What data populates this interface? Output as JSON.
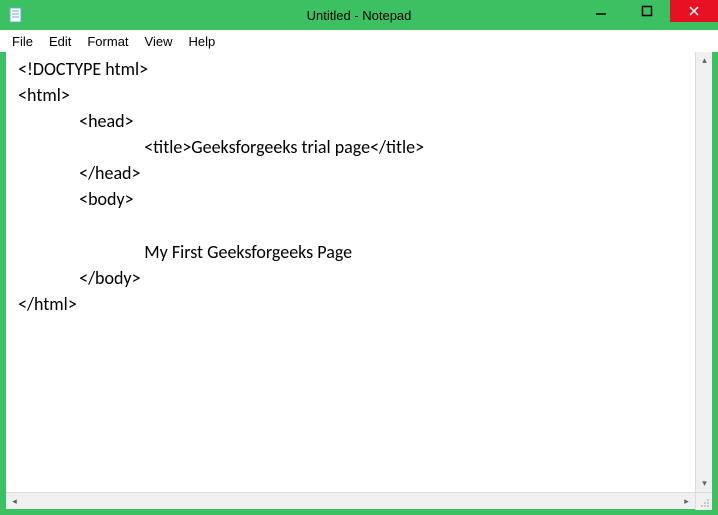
{
  "window": {
    "title": "Untitled - Notepad"
  },
  "menu": {
    "file": "File",
    "edit": "Edit",
    "format": "Format",
    "view": "View",
    "help": "Help"
  },
  "editor": {
    "content": " <!DOCTYPE html>\n <html>\n                <head>\n                                <title>Geeksforgeeks trial page</title>\n                </head>\n                <body>\n\n                                My First Geeksforgeeks Page\n                </body>\n </html>"
  }
}
